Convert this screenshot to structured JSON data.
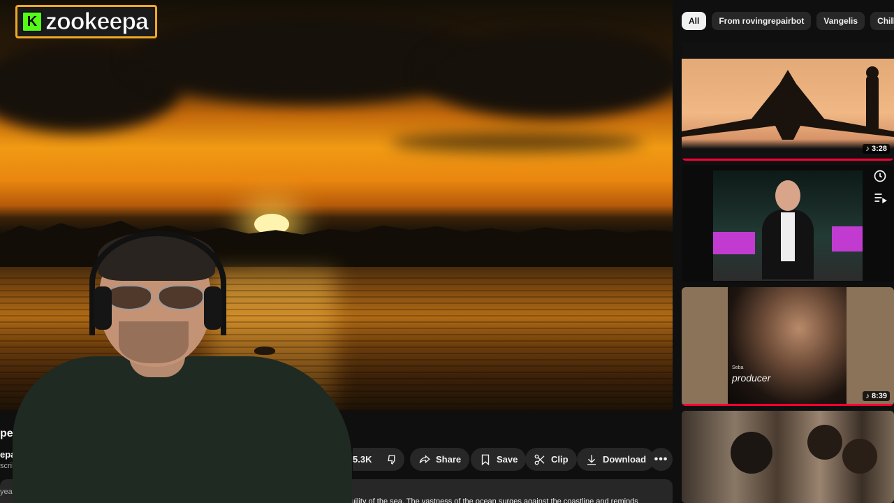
{
  "overlay": {
    "logo_letter": "K",
    "logo_text": "zookeepa",
    "logo_border_color": "#f0a825",
    "logo_accent_color": "#53fc18"
  },
  "video": {
    "title_partial": "penin",
    "channel_partial": "epairbo",
    "subscribers_partial": "scribers",
    "age_partial": "yea",
    "description_partial": "ene tranquility of the sea. The vastness of the ocean surges against the coastline and reminds"
  },
  "actions": {
    "likes": "5.3K",
    "share": "Share",
    "save": "Save",
    "clip": "Clip",
    "download": "Download"
  },
  "chips": [
    "All",
    "From rovingrepairbot",
    "Vangelis",
    "Chill-out"
  ],
  "recommendations": [
    {
      "duration": "3:28",
      "icon": "music-note-icon",
      "progress": 1.0
    },
    {
      "duration": "",
      "icon": "",
      "progress": 0
    },
    {
      "duration": "8:39",
      "icon": "music-note-icon",
      "progress": 1.0,
      "cover_artist": "Seba",
      "cover_title": "producer"
    },
    {
      "duration": "",
      "icon": "",
      "progress": 0
    }
  ],
  "colors": {
    "background": "#0f0f0f",
    "pill": "#272727",
    "progress_red": "#ff0033"
  }
}
